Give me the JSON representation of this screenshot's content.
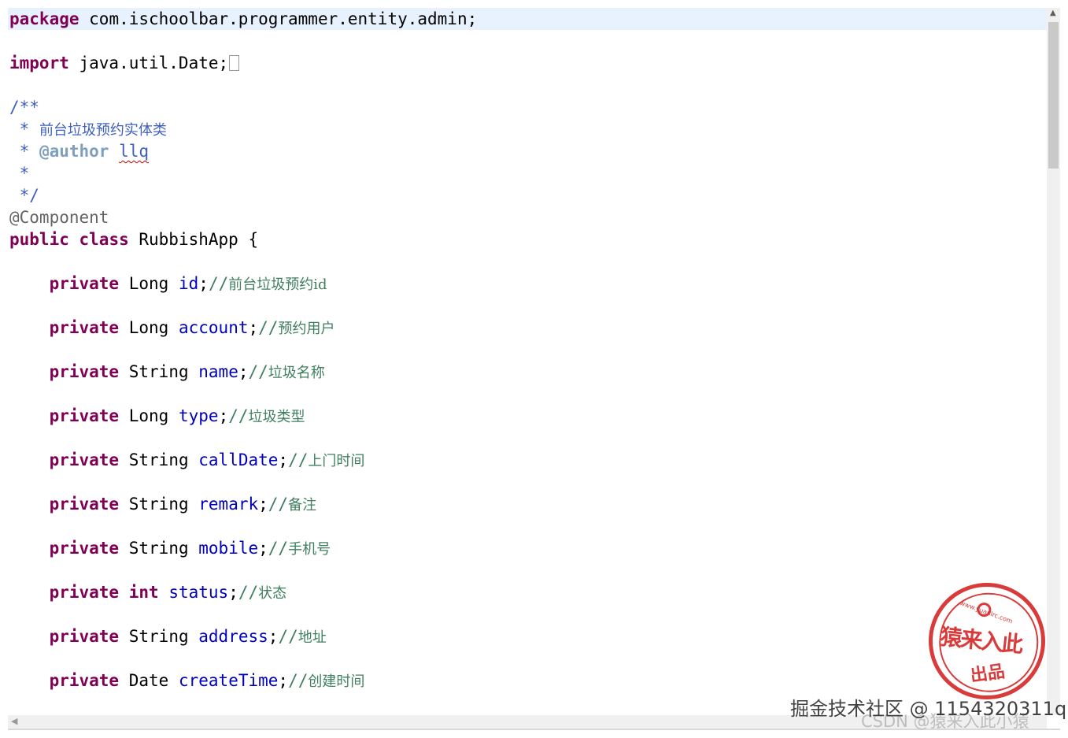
{
  "code": {
    "package_kw": "package",
    "package_name": " com.ischoolbar.programmer.entity.admin;",
    "import_kw": "import",
    "import_name": " java.util.Date;",
    "javadoc_open": "/**",
    "javadoc_star": " * ",
    "javadoc_desc": "前台垃圾预约实体类",
    "author_tag": "@author",
    "author_name": "llq",
    "javadoc_empty": " *",
    "javadoc_close": " */",
    "annotation": "@Component",
    "public_kw": "public",
    "class_kw": "class",
    "class_name": " RubbishApp {",
    "private_kw": "private",
    "fields": [
      {
        "type": "Long",
        "name": "id",
        "comment": "前台垃圾预约id"
      },
      {
        "type": "Long",
        "name": "account",
        "comment": "预约用户"
      },
      {
        "type": "String",
        "name": "name",
        "comment": "垃圾名称"
      },
      {
        "type": "Long",
        "name": "type",
        "comment": "垃圾类型"
      },
      {
        "type": "String",
        "name": "callDate",
        "comment": "上门时间"
      },
      {
        "type": "String",
        "name": "remark",
        "comment": "备注"
      },
      {
        "type": "String",
        "name": "mobile",
        "comment": "手机号"
      },
      {
        "type": "int",
        "name": "status",
        "comment": "状态"
      },
      {
        "type": "String",
        "name": "address",
        "comment": "地址"
      },
      {
        "type": "Date",
        "name": "createTime",
        "comment": "创建时间"
      }
    ]
  },
  "stamp": {
    "url": "www.yuanlrc.com",
    "main": "猿来入此",
    "sub": "出品"
  },
  "watermarks": {
    "juejin": "掘金技术社区 @ 1154320311q",
    "csdn": "CSDN @猿来入此小猿"
  },
  "colors": {
    "keyword": "#7f0055",
    "field": "#0000c0",
    "comment": "#3f7f5f",
    "javadoc": "#3f5fbf",
    "stamp": "#d42020",
    "current_line": "#e8f2fe"
  }
}
